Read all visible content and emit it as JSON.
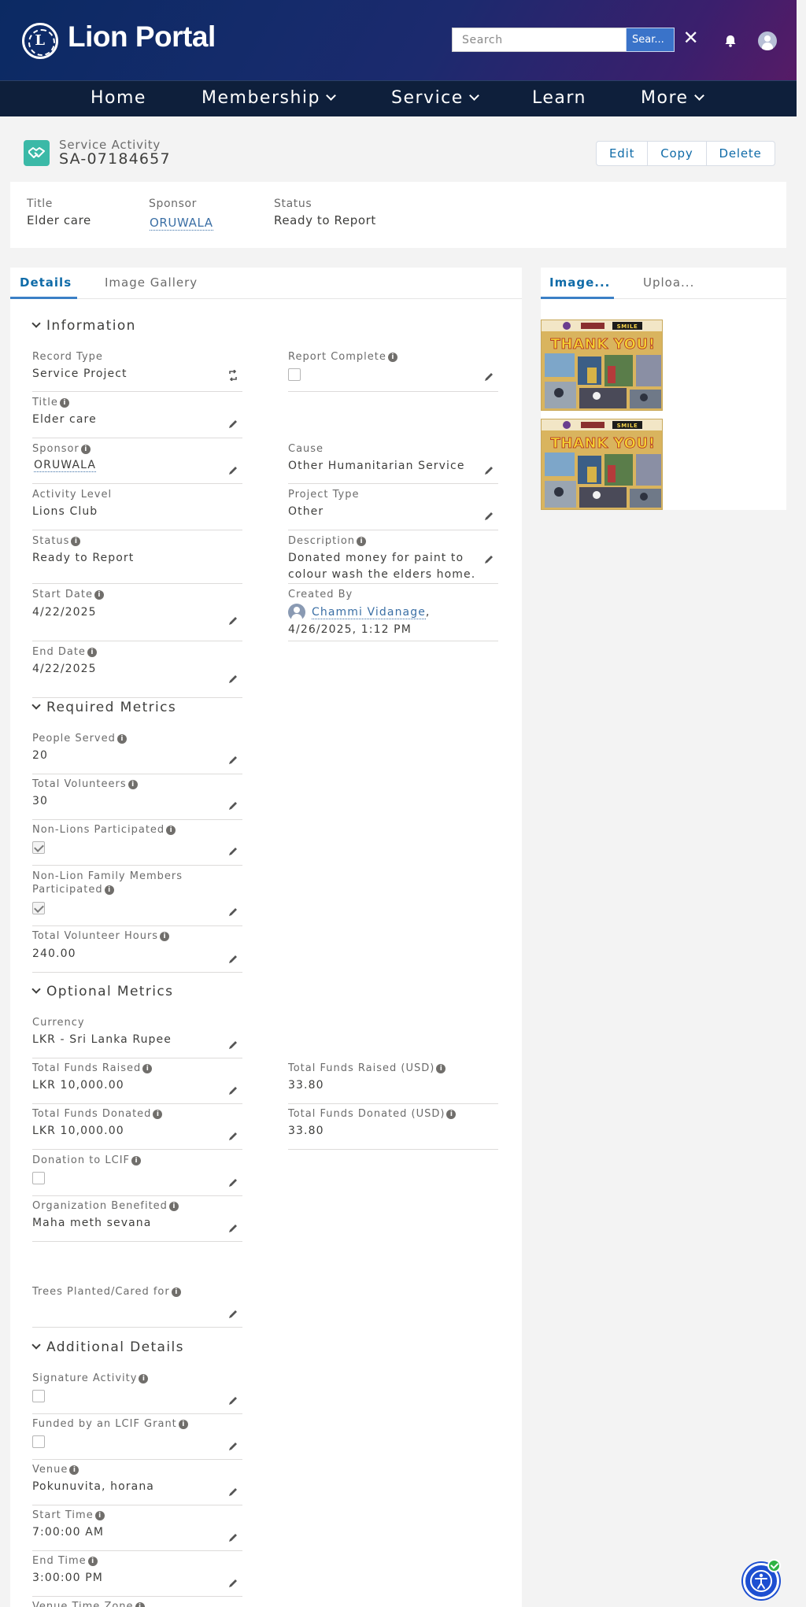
{
  "header": {
    "logo_text": "Lion Portal",
    "search_placeholder": "Search",
    "search_button": "Sear..."
  },
  "nav": {
    "items": [
      {
        "label": "Home"
      },
      {
        "label": "Membership"
      },
      {
        "label": "Service"
      },
      {
        "label": "Learn"
      },
      {
        "label": "More"
      }
    ]
  },
  "record": {
    "type": "Service Activity",
    "name": "SA-07184657",
    "actions": {
      "edit": "Edit",
      "copy": "Copy",
      "delete": "Delete"
    }
  },
  "highlights": {
    "title_label": "Title",
    "title_value": "Elder care",
    "sponsor_label": "Sponsor",
    "sponsor_value": "ORUWALA",
    "status_label": "Status",
    "status_value": "Ready to Report"
  },
  "tabs": {
    "details": "Details",
    "gallery": "Image Gallery"
  },
  "side": {
    "tab_images": "Image...",
    "tab_upload": "Uploa..."
  },
  "sections": {
    "information": "Information",
    "required": "Required Metrics",
    "optional": "Optional Metrics",
    "additional": "Additional Details"
  },
  "info": {
    "record_type_label": "Record Type",
    "record_type_value": "Service Project",
    "report_complete_label": "Report Complete",
    "report_complete_checked": false,
    "title_label": "Title",
    "title_value": "Elder care",
    "sponsor_label": "Sponsor",
    "sponsor_value": "ORUWALA",
    "cause_label": "Cause",
    "cause_value": "Other Humanitarian Service",
    "activity_level_label": "Activity Level",
    "activity_level_value": "Lions Club",
    "project_type_label": "Project Type",
    "project_type_value": "Other",
    "status_label": "Status",
    "status_value": "Ready to Report",
    "description_label": "Description",
    "description_line1": "Donated money for paint to",
    "description_line2": "colour wash the elders home.",
    "start_date_label": "Start Date",
    "start_date_value": "4/22/2025",
    "created_by_label": "Created By",
    "created_by_name": "Chammi Vidanage",
    "created_by_sep": ",",
    "created_by_date": "4/26/2025, 1:12 PM",
    "end_date_label": "End Date",
    "end_date_value": "4/22/2025"
  },
  "required": {
    "people_served_label": "People Served",
    "people_served_value": "20",
    "total_volunteers_label": "Total Volunteers",
    "total_volunteers_value": "30",
    "non_lions_label": "Non-Lions Participated",
    "non_lions_checked": true,
    "non_lion_family_label1": "Non-Lion Family Members",
    "non_lion_family_label2": "Participated",
    "non_lion_family_checked": true,
    "volunteer_hours_label": "Total Volunteer Hours",
    "volunteer_hours_value": "240.00"
  },
  "optional": {
    "currency_label": "Currency",
    "currency_value": "LKR - Sri Lanka Rupee",
    "funds_raised_label": "Total Funds Raised",
    "funds_raised_value": "LKR 10,000.00",
    "funds_raised_usd_label": "Total Funds Raised (USD)",
    "funds_raised_usd_value": "33.80",
    "funds_donated_label": "Total Funds Donated",
    "funds_donated_value": "LKR 10,000.00",
    "funds_donated_usd_label": "Total Funds Donated (USD)",
    "funds_donated_usd_value": "33.80",
    "lcif_label": "Donation to LCIF",
    "lcif_checked": false,
    "org_benefited_label": "Organization Benefited",
    "org_benefited_value": "Maha meth sevana",
    "trees_label": "Trees Planted/Cared for"
  },
  "additional": {
    "signature_label": "Signature Activity",
    "signature_checked": false,
    "lcif_grant_label": "Funded by an LCIF Grant",
    "lcif_grant_checked": false,
    "venue_label": "Venue",
    "venue_value": "Pokunuvita, horana",
    "start_time_label": "Start Time",
    "start_time_value": "7:00:00 AM",
    "end_time_label": "End Time",
    "end_time_value": "3:00:00 PM",
    "venue_tz_label": "Venue Time Zone"
  },
  "gallery": {
    "thumb_heading": "THANK YOU!",
    "thumb_logo_text": "SMILE"
  },
  "icons": {
    "record": "handshake-icon",
    "edit": "pencil-icon",
    "info": "info-icon",
    "bell": "bell-icon",
    "user": "user-avatar-icon",
    "accessibility": "accessibility-icon"
  },
  "colors": {
    "brand_dark": "#0e1f3b",
    "brand_gradient_start": "#0b2a63",
    "brand_gradient_end": "#561b66",
    "link": "#3b6fa5",
    "accent_blue": "#3b80c6",
    "record_icon": "#3bb9a7"
  }
}
